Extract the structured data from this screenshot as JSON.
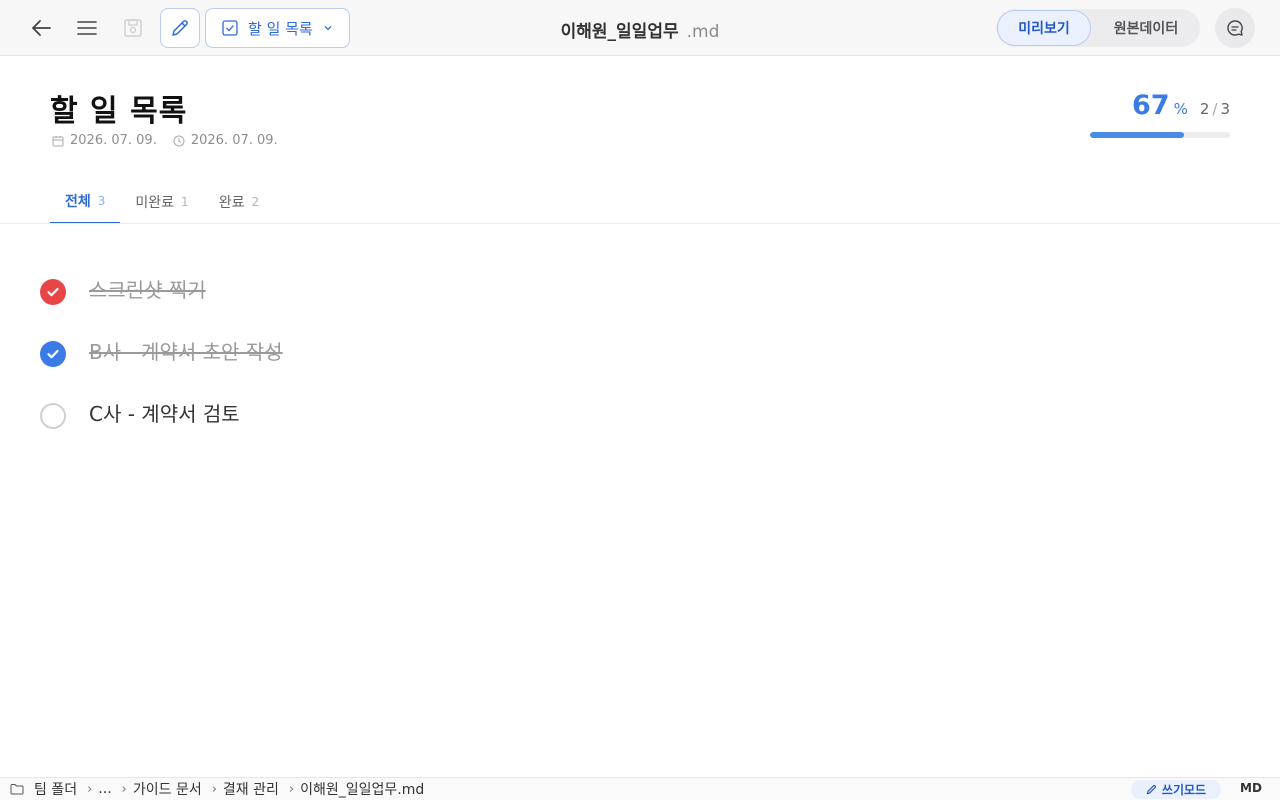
{
  "toolbar": {
    "view_select_label": "할 일 목록",
    "doc_name": "이해원_일일업무",
    "doc_ext": ".md",
    "preview_label": "미리보기",
    "raw_label": "원본데이터"
  },
  "page": {
    "title": "할 일 목록",
    "created_date": "2026. 07. 09.",
    "modified_date": "2026. 07. 09."
  },
  "progress": {
    "percent": "67",
    "percent_unit": "%",
    "done": "2",
    "total": "3",
    "fill_fraction": 0.67
  },
  "tabs": [
    {
      "label": "전체",
      "count": "3"
    },
    {
      "label": "미완료",
      "count": "1"
    },
    {
      "label": "완료",
      "count": "2"
    }
  ],
  "tasks": [
    {
      "text": "스크린샷 찍기",
      "done": true,
      "color": "#e84646"
    },
    {
      "text": "B사 - 계약서 초안 작성",
      "done": true,
      "color": "#3b7be8"
    },
    {
      "text": "C사 - 계약서 검토",
      "done": false,
      "color": "#cfcfd2"
    }
  ],
  "statusbar": {
    "breadcrumb": [
      "팀 폴더",
      "...",
      "가이드 문서",
      "결재 관리",
      "이해원_일일업무.md"
    ],
    "mode_label": "쓰기모드",
    "format_label": "MD"
  },
  "colors": {
    "accent": "#2f6bd8",
    "progress": "#4a8ae8",
    "check_red": "#e84646",
    "check_blue": "#3b7be8"
  }
}
